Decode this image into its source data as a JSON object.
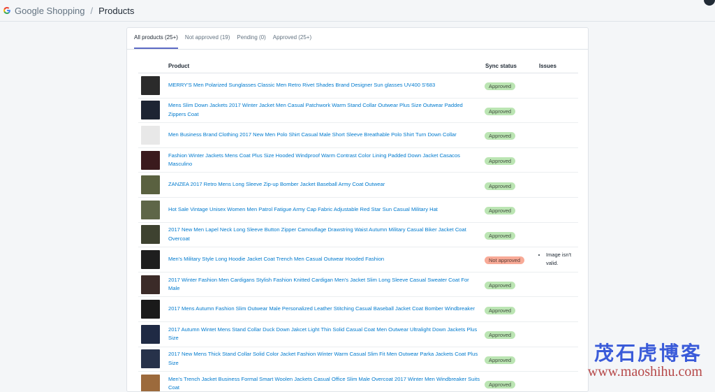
{
  "header": {
    "app_name": "Google Shopping",
    "separator": "/",
    "page_title": "Products"
  },
  "tabs": [
    {
      "label": "All products (25+)",
      "active": true
    },
    {
      "label": "Not approved (19)",
      "active": false
    },
    {
      "label": "Pending (0)",
      "active": false
    },
    {
      "label": "Approved (25+)",
      "active": false
    }
  ],
  "table": {
    "columns": {
      "product": "Product",
      "sync": "Sync status",
      "issues": "Issues"
    },
    "rows": [
      {
        "product": "MERRY'S Men Polarized Sunglasses Classic Men Retro Rivet Shades Brand Designer Sun glasses UV400 S'683",
        "status": "Approved",
        "issues": "",
        "thumb_color": "#2b2b2b"
      },
      {
        "product": "Mens Slim Down Jackets 2017 Winter Jacket Men Casual Patchwork Warm Stand Collar Outwear Plus Size Outwear Padded Zippers Coat",
        "status": "Approved",
        "issues": "",
        "thumb_color": "#1d2433"
      },
      {
        "product": "Men Business Brand Clothing 2017 New Men Polo Shirt Casual Male Short Sleeve Breathable Polo Shirt Turn Down Collar",
        "status": "Approved",
        "issues": "",
        "thumb_color": "#e8e8e8"
      },
      {
        "product": "Fashion Winter Jackets Mens Coat Plus Size Hooded Windproof Warm Contrast Color Lining Padded Down Jacket Casacos Masculino",
        "status": "Approved",
        "issues": "",
        "thumb_color": "#3a1a1d"
      },
      {
        "product": "ZANZEA 2017 Retro Mens Long Sleeve Zip-up Bomber Jacket Baseball Army Coat Outwear",
        "status": "Approved",
        "issues": "",
        "thumb_color": "#5a6140"
      },
      {
        "product": "Hot Sale Vintage Unisex Women Men Patrol Fatigue Army Cap Fabric Adjustable Red Star Sun Casual Military Hat",
        "status": "Approved",
        "issues": "",
        "thumb_color": "#5e6648"
      },
      {
        "product": "2017 New Men Lapel Neck Long Sleeve Button Zipper Camouflage Drawstring Waist Autumn Military Casual Biker Jacket Coat Overcoat",
        "status": "Approved",
        "issues": "",
        "thumb_color": "#3e4230"
      },
      {
        "product": "Men's Military Style Long Hoodie Jacket Coat Trench Men Casual Outwear Hooded Fashion",
        "status": "Not approved",
        "issues": "Image isn't valid.",
        "thumb_color": "#1e1e1e"
      },
      {
        "product": "2017 Winter Fashion Men Cardigans Stylish Fashion Knitted Cardigan Men's Jacket Slim Long Sleeve Casual Sweater Coat For Male",
        "status": "Approved",
        "issues": "",
        "thumb_color": "#3b2b28"
      },
      {
        "product": "2017 Mens Autumn Fashion Slim Outwear Male Personalized Leather Stitching Casual Baseball Jacket Coat Bomber Windbreaker",
        "status": "Approved",
        "issues": "",
        "thumb_color": "#1a1a1a"
      },
      {
        "product": "2017 Autumn Wintet Mens Stand Collar Duck Down Jakcet Light Thin Solid Casual Coat Men Outwear Ultralight Down Jackets Plus Size",
        "status": "Approved",
        "issues": "",
        "thumb_color": "#1f2a44"
      },
      {
        "product": "2017 New Mens Thick Stand Collar Solid Color Jacket Fashion Winter Warm Casual Slim Fit Men Outwear Parka Jackets Coat Plus Size",
        "status": "Approved",
        "issues": "",
        "thumb_color": "#27324a"
      },
      {
        "product": "Men's Trench Jacket Business Formal Smart Woolen Jackets Casual Office Slim Male Overcoat 2017 Winter Men Windbreaker Suits Coat",
        "status": "Approved",
        "issues": "",
        "thumb_color": "#9c6a3c"
      }
    ]
  },
  "watermark": {
    "line1": "茂石虎博客",
    "line2": "www.maoshihu.com"
  },
  "colors": {
    "approved_bg": "#bbe5b3",
    "not_approved_bg": "#f8aa97",
    "link": "#007ace",
    "tab_underline": "#5c6ac4"
  }
}
